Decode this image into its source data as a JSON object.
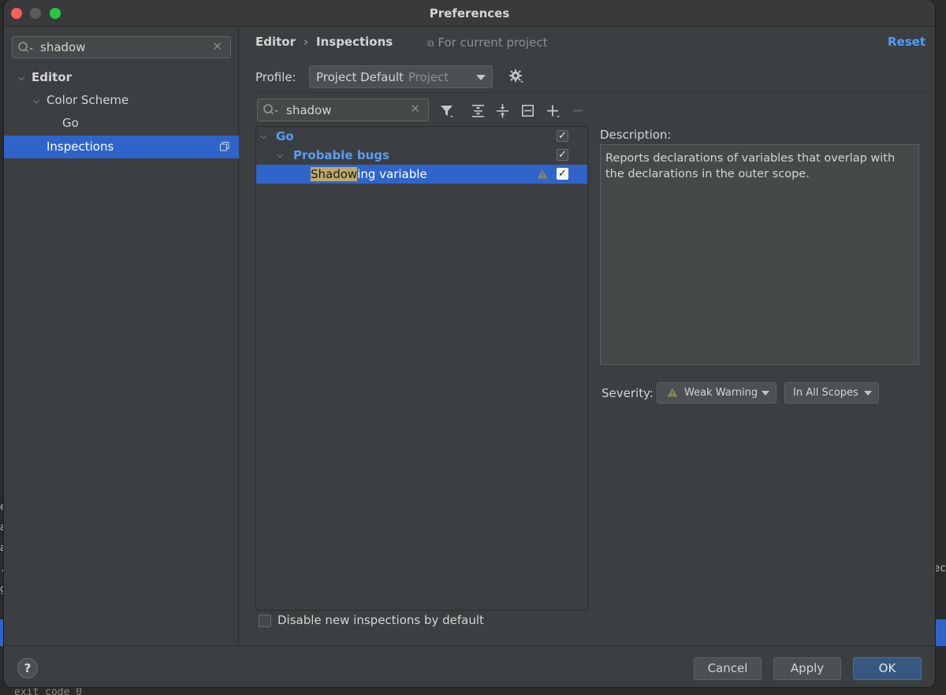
{
  "window": {
    "title": "Preferences"
  },
  "sidebar": {
    "search_value": "shadow",
    "items": [
      {
        "label": "Editor",
        "level": 0,
        "expanded": true
      },
      {
        "label": "Color Scheme",
        "level": 1,
        "expanded": true
      },
      {
        "label": "Go",
        "level": 2
      },
      {
        "label": "Inspections",
        "level": 1,
        "selected": true
      }
    ]
  },
  "header": {
    "breadcrumb": [
      "Editor",
      "Inspections"
    ],
    "scope_note": "For current project",
    "reset_label": "Reset"
  },
  "profile": {
    "label": "Profile:",
    "value": "Project Default",
    "sub": "Project"
  },
  "filter": {
    "search_value": "shadow"
  },
  "inspections": {
    "rows": [
      {
        "label": "Go",
        "checked": true
      },
      {
        "label": "Probable bugs",
        "checked": true
      },
      {
        "label_highlight": "Shadow",
        "label_rest": "ing variable",
        "checked": true,
        "selected": true
      }
    ]
  },
  "description": {
    "label": "Description:",
    "text": "Reports declarations of variables that overlap with the declarations in the outer scope."
  },
  "severity": {
    "label": "Severity:",
    "level": "Weak Warning",
    "scope": "In All Scopes"
  },
  "options": {
    "disable_new_label": "Disable new inspections by default",
    "disable_new_checked": false
  },
  "footer": {
    "help": "?",
    "cancel": "Cancel",
    "apply": "Apply",
    "ok": "OK"
  },
  "background": {
    "bottom_text": "exit code 0"
  },
  "colors": {
    "accent": "#2f65ca",
    "link": "#589df6",
    "panel": "#3c3f41",
    "highlight": "#bfa96a"
  }
}
